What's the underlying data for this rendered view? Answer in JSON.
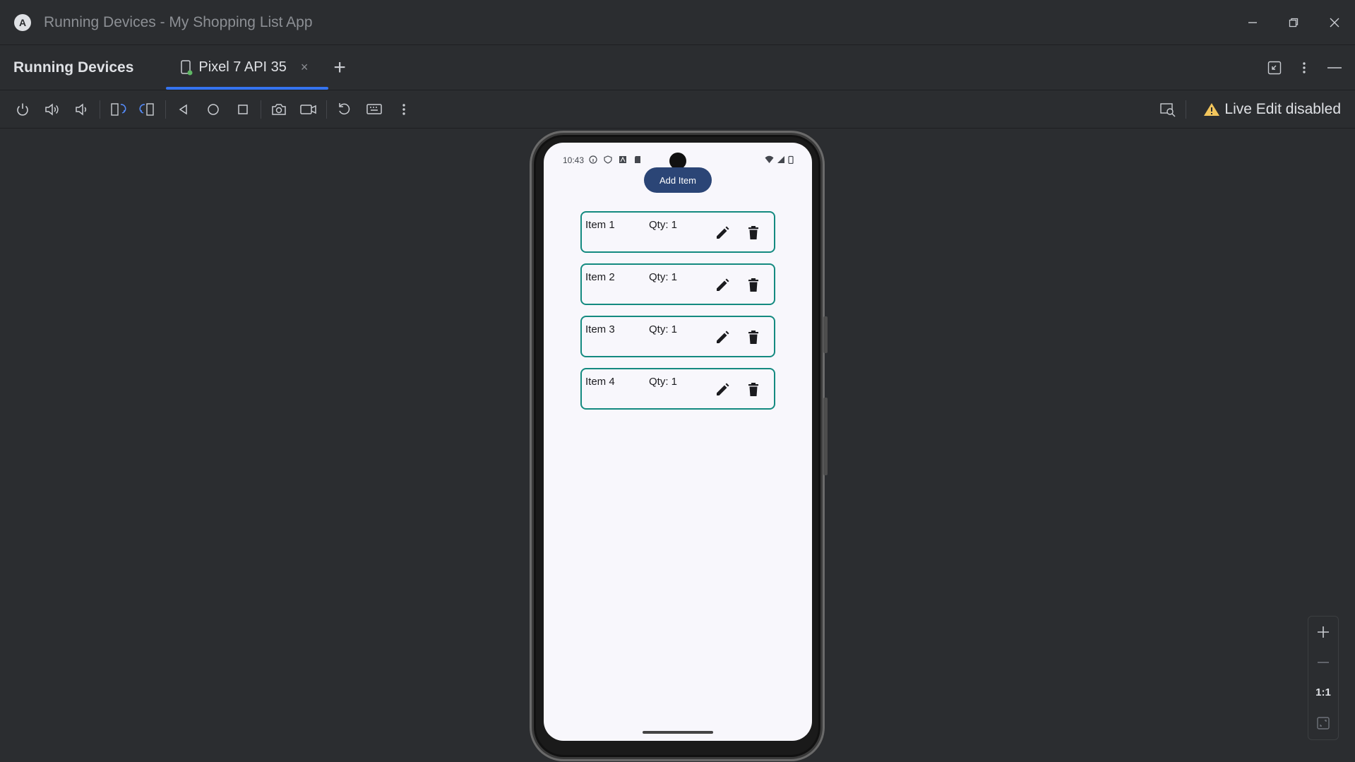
{
  "window": {
    "title": "Running Devices - My Shopping List App",
    "logo_letter": "A"
  },
  "panel": {
    "title": "Running Devices",
    "tab_label": "Pixel 7 API 35",
    "tab_close": "×"
  },
  "toolbar": {
    "buttons": [
      "power-icon",
      "volume-up-icon",
      "volume-down-icon",
      "rotate-left-icon",
      "rotate-right-icon",
      "back-icon",
      "home-icon",
      "overview-icon",
      "screenshot-icon",
      "screen-record-icon",
      "reset-icon",
      "keyboard-icon",
      "more-options-icon"
    ],
    "live_edit_label": "Live Edit disabled"
  },
  "phone": {
    "status_time": "10:43",
    "add_button": "Add Item",
    "items": [
      {
        "name": "Item 1",
        "qty": "Qty: 1"
      },
      {
        "name": "Item 2",
        "qty": "Qty: 1"
      },
      {
        "name": "Item 3",
        "qty": "Qty: 1"
      },
      {
        "name": "Item 4",
        "qty": "Qty: 1"
      }
    ]
  },
  "zoom": {
    "in": "+",
    "out": "—",
    "actual": "1:1"
  },
  "colors": {
    "accent": "#3574f0",
    "card_border": "#148a80",
    "add_button_bg": "#2b4576",
    "warning": "#f2c55c"
  }
}
